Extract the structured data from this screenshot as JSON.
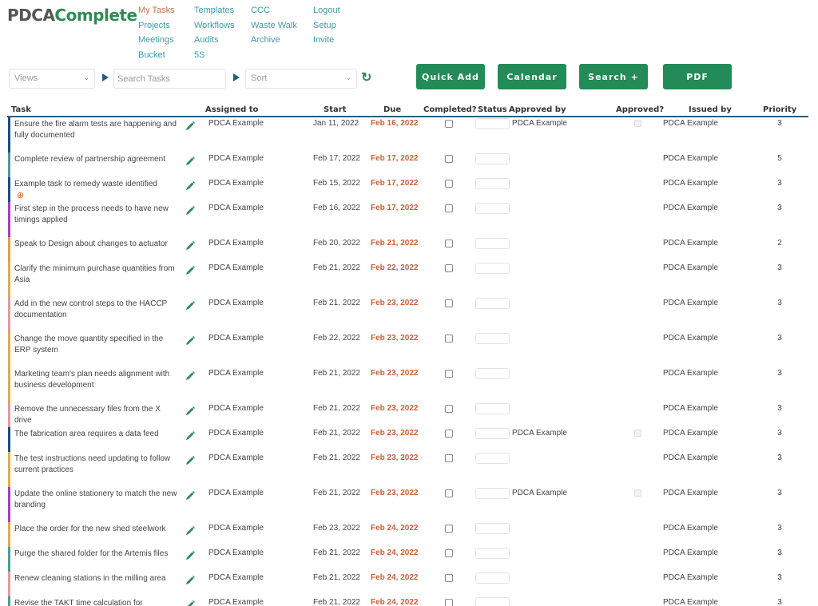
{
  "brand": {
    "part1": "PDCA",
    "part2": "Complete"
  },
  "nav": {
    "col1": [
      {
        "label": "My Tasks",
        "active": true
      },
      {
        "label": "Projects"
      },
      {
        "label": "Meetings"
      },
      {
        "label": "Bucket"
      }
    ],
    "col2": [
      {
        "label": "Templates"
      },
      {
        "label": "Workflows"
      },
      {
        "label": "Audits"
      },
      {
        "label": "5S"
      }
    ],
    "col3": [
      {
        "label": "CCC"
      },
      {
        "label": "Waste Walk"
      },
      {
        "label": "Archive"
      }
    ],
    "col4": [
      {
        "label": "Logout"
      },
      {
        "label": "Setup"
      },
      {
        "label": "Invite"
      }
    ]
  },
  "toolbar": {
    "views_value": "Views",
    "search_placeholder": "Search Tasks",
    "sort_value": "Sort",
    "buttons": {
      "quick_add": "Quick Add",
      "calendar": "Calendar",
      "search_plus": "Search +",
      "pdf": "PDF"
    }
  },
  "table": {
    "headers": {
      "task": "Task",
      "assigned": "Assigned to",
      "start": "Start",
      "due": "Due",
      "completed": "Completed?",
      "status": "Status",
      "approved_by": "Approved by",
      "approved": "Approved?",
      "issued_by": "Issued by",
      "priority": "Priority"
    },
    "rows": [
      {
        "task": "Ensure the fire alarm tests are happening and fully documented",
        "color": "#1f4e79",
        "assigned": "PDCA Example",
        "start": "Jan 11, 2022",
        "due": "Feb 16, 2022",
        "approved_by": "PDCA Example",
        "has_approval": true,
        "issued_by": "PDCA Example",
        "priority": "3",
        "lines": 2
      },
      {
        "task": "Complete review of partnership agreement",
        "color": "#4f9a94",
        "assigned": "PDCA Example",
        "start": "Feb 17, 2022",
        "due": "Feb 17, 2022",
        "approved_by": "",
        "has_approval": false,
        "issued_by": "PDCA Example",
        "priority": "5",
        "lines": 1
      },
      {
        "task": "Example task to remedy waste identified",
        "color": "#1f4e79",
        "plus": true,
        "assigned": "PDCA Example",
        "start": "Feb 15, 2022",
        "due": "Feb 17, 2022",
        "approved_by": "",
        "has_approval": false,
        "issued_by": "PDCA Example",
        "priority": "3",
        "lines": 1
      },
      {
        "task": "First step in the process needs to have new timings applied",
        "color": "#a43ec8",
        "assigned": "PDCA Example",
        "start": "Feb 16, 2022",
        "due": "Feb 17, 2022",
        "approved_by": "",
        "has_approval": false,
        "issued_by": "PDCA Example",
        "priority": "3",
        "lines": 2
      },
      {
        "task": "Speak to Design about changes to actuator",
        "color": "#e0a23a",
        "assigned": "PDCA Example",
        "start": "Feb 20, 2022",
        "due": "Feb 21, 2022",
        "approved_by": "",
        "has_approval": false,
        "issued_by": "PDCA Example",
        "priority": "2",
        "lines": 1
      },
      {
        "task": "Clarify the minimum purchase quantities from Asia",
        "color": "#d8b04a",
        "assigned": "PDCA Example",
        "start": "Feb 21, 2022",
        "due": "Feb 22, 2022",
        "approved_by": "",
        "has_approval": false,
        "issued_by": "PDCA Example",
        "priority": "3",
        "lines": 2
      },
      {
        "task": "Add in the new control steps to the HACCP documentation",
        "color": "#e09aa0",
        "assigned": "PDCA Example",
        "start": "Feb 21, 2022",
        "due": "Feb 23, 2022",
        "approved_by": "",
        "has_approval": false,
        "issued_by": "PDCA Example",
        "priority": "3",
        "lines": 2
      },
      {
        "task": "Change the move quantity specified in the ERP system",
        "color": "#d8b04a",
        "assigned": "PDCA Example",
        "start": "Feb 22, 2022",
        "due": "Feb 23, 2022",
        "approved_by": "",
        "has_approval": false,
        "issued_by": "PDCA Example",
        "priority": "3",
        "lines": 2
      },
      {
        "task": "Marketing team's plan needs alignment with business development",
        "color": "#d8b04a",
        "assigned": "PDCA Example",
        "start": "Feb 21, 2022",
        "due": "Feb 23, 2022",
        "approved_by": "",
        "has_approval": false,
        "issued_by": "PDCA Example",
        "priority": "3",
        "lines": 2
      },
      {
        "task": "Remove the unnecessary files from the X drive",
        "color": "#e09aa0",
        "assigned": "PDCA Example",
        "start": "Feb 21, 2022",
        "due": "Feb 23, 2022",
        "approved_by": "",
        "has_approval": false,
        "issued_by": "PDCA Example",
        "priority": "3",
        "lines": 1
      },
      {
        "task": "The fabrication area requires a data feed",
        "color": "#1f4e79",
        "assigned": "PDCA Example",
        "start": "Feb 21, 2022",
        "due": "Feb 23, 2022",
        "approved_by": "PDCA Example",
        "has_approval": true,
        "issued_by": "PDCA Example",
        "priority": "3",
        "lines": 1
      },
      {
        "task": "The test instructions need updating to follow current practices",
        "color": "#d8b04a",
        "assigned": "PDCA Example",
        "start": "Feb 21, 2022",
        "due": "Feb 23, 2022",
        "approved_by": "",
        "has_approval": false,
        "issued_by": "PDCA Example",
        "priority": "3",
        "lines": 2
      },
      {
        "task": "Update the online stationery to match the new branding",
        "color": "#a43ec8",
        "assigned": "PDCA Example",
        "start": "Feb 21, 2022",
        "due": "Feb 23, 2022",
        "approved_by": "PDCA Example",
        "has_approval": true,
        "issued_by": "PDCA Example",
        "priority": "3",
        "lines": 2
      },
      {
        "task": "Place the order for the new shed steelwork",
        "color": "#d8b04a",
        "assigned": "PDCA Example",
        "start": "Feb 23, 2022",
        "due": "Feb 24, 2022",
        "approved_by": "",
        "has_approval": false,
        "issued_by": "PDCA Example",
        "priority": "3",
        "lines": 1
      },
      {
        "task": "Purge the shared folder for the Artemis files",
        "color": "#4f9a94",
        "assigned": "PDCA Example",
        "start": "Feb 21, 2022",
        "due": "Feb 24, 2022",
        "approved_by": "",
        "has_approval": false,
        "issued_by": "PDCA Example",
        "priority": "3",
        "lines": 1
      },
      {
        "task": "Renew cleaning stations in the milling area",
        "color": "#e09aa0",
        "assigned": "PDCA Example",
        "start": "Feb 21, 2022",
        "due": "Feb 24, 2022",
        "approved_by": "",
        "has_approval": false,
        "issued_by": "PDCA Example",
        "priority": "3",
        "lines": 1
      },
      {
        "task": "Revise the TAKT time calculation for",
        "color": "#4f9a94",
        "assigned": "PDCA Example",
        "start": "Feb 21, 2022",
        "due": "Feb 24, 2022",
        "approved_by": "",
        "has_approval": false,
        "issued_by": "PDCA Example",
        "priority": "3",
        "lines": 2
      }
    ]
  }
}
